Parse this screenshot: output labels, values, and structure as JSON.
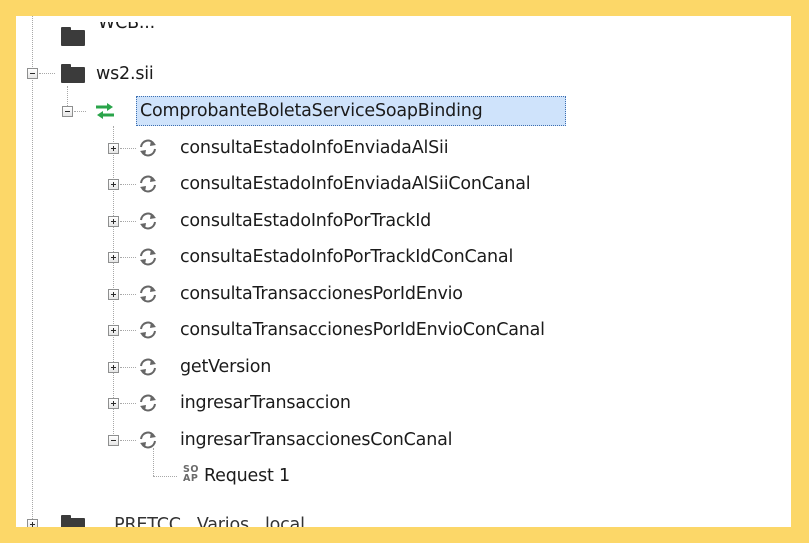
{
  "colors": {
    "frame": "#fcd768",
    "selection": "#cfe3fb",
    "binding_icon": "#2aa44a",
    "op_icon": "#666666"
  },
  "tree": {
    "top_partial_label": "WCB...",
    "project": {
      "label": "ws2.sii",
      "icon": "folder-icon"
    },
    "binding": {
      "label": "ComprobanteBoletaServiceSoapBinding",
      "icon": "binding-arrows-icon"
    },
    "operations": [
      {
        "label": "consultaEstadoInfoEnviadaAlSii",
        "expanded": false
      },
      {
        "label": "consultaEstadoInfoEnviadaAlSiiConCanal",
        "expanded": false
      },
      {
        "label": "consultaEstadoInfoPorTrackId",
        "expanded": false
      },
      {
        "label": "consultaEstadoInfoPorTrackIdConCanal",
        "expanded": false
      },
      {
        "label": "consultaTransaccionesPorIdEnvio",
        "expanded": false
      },
      {
        "label": "consultaTransaccionesPorIdEnvioConCanal",
        "expanded": false
      },
      {
        "label": "getVersion",
        "expanded": false
      },
      {
        "label": "ingresarTransaccion",
        "expanded": false
      },
      {
        "label": "ingresarTransaccionesConCanal",
        "expanded": true
      }
    ],
    "request": {
      "label": "Request 1",
      "icon_line1": "SO",
      "icon_line2": "AP"
    },
    "bottom_partial_label": "...PRETCC...Varios...local"
  }
}
